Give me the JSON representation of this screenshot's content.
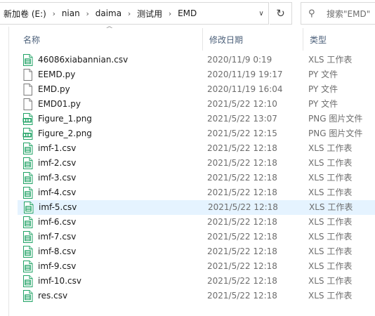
{
  "address_bar": {
    "crumbs": [
      "新加卷 (E:)",
      "nian",
      "daima",
      "测试用",
      "EMD"
    ],
    "separator": "›"
  },
  "search": {
    "placeholder": "搜索\"EMD\""
  },
  "columns": {
    "name": "名称",
    "date": "修改日期",
    "type": "类型"
  },
  "files": [
    {
      "name": "46086xiabannian.csv",
      "date": "2020/11/9 0:19",
      "type": "XLS 工作表",
      "icon": "excel-csv-icon"
    },
    {
      "name": "EEMD.py",
      "date": "2020/11/19 19:17",
      "type": "PY 文件",
      "icon": "generic-file-icon"
    },
    {
      "name": "EMD.py",
      "date": "2020/11/19 16:04",
      "type": "PY 文件",
      "icon": "generic-file-icon"
    },
    {
      "name": "EMD01.py",
      "date": "2021/5/22 12:10",
      "type": "PY 文件",
      "icon": "generic-file-icon"
    },
    {
      "name": "Figure_1.png",
      "date": "2021/5/22 13:07",
      "type": "PNG 图片文件",
      "icon": "png-image-icon"
    },
    {
      "name": "Figure_2.png",
      "date": "2021/5/22 12:15",
      "type": "PNG 图片文件",
      "icon": "png-image-icon"
    },
    {
      "name": "imf-1.csv",
      "date": "2021/5/22 12:18",
      "type": "XLS 工作表",
      "icon": "excel-csv-icon"
    },
    {
      "name": "imf-2.csv",
      "date": "2021/5/22 12:18",
      "type": "XLS 工作表",
      "icon": "excel-csv-icon"
    },
    {
      "name": "imf-3.csv",
      "date": "2021/5/22 12:18",
      "type": "XLS 工作表",
      "icon": "excel-csv-icon"
    },
    {
      "name": "imf-4.csv",
      "date": "2021/5/22 12:18",
      "type": "XLS 工作表",
      "icon": "excel-csv-icon"
    },
    {
      "name": "imf-5.csv",
      "date": "2021/5/22 12:18",
      "type": "XLS 工作表",
      "icon": "excel-csv-icon",
      "selected": true
    },
    {
      "name": "imf-6.csv",
      "date": "2021/5/22 12:18",
      "type": "XLS 工作表",
      "icon": "excel-csv-icon"
    },
    {
      "name": "imf-7.csv",
      "date": "2021/5/22 12:18",
      "type": "XLS 工作表",
      "icon": "excel-csv-icon"
    },
    {
      "name": "imf-8.csv",
      "date": "2021/5/22 12:18",
      "type": "XLS 工作表",
      "icon": "excel-csv-icon"
    },
    {
      "name": "imf-9.csv",
      "date": "2021/5/22 12:18",
      "type": "XLS 工作表",
      "icon": "excel-csv-icon"
    },
    {
      "name": "imf-10.csv",
      "date": "2021/5/22 12:18",
      "type": "XLS 工作表",
      "icon": "excel-csv-icon"
    },
    {
      "name": "res.csv",
      "date": "2021/5/22 12:18",
      "type": "XLS 工作表",
      "icon": "excel-csv-icon"
    }
  ],
  "colors": {
    "selected_row": "#e5f3ff",
    "header_text": "#4c607a",
    "excel_green": "#21a366"
  }
}
